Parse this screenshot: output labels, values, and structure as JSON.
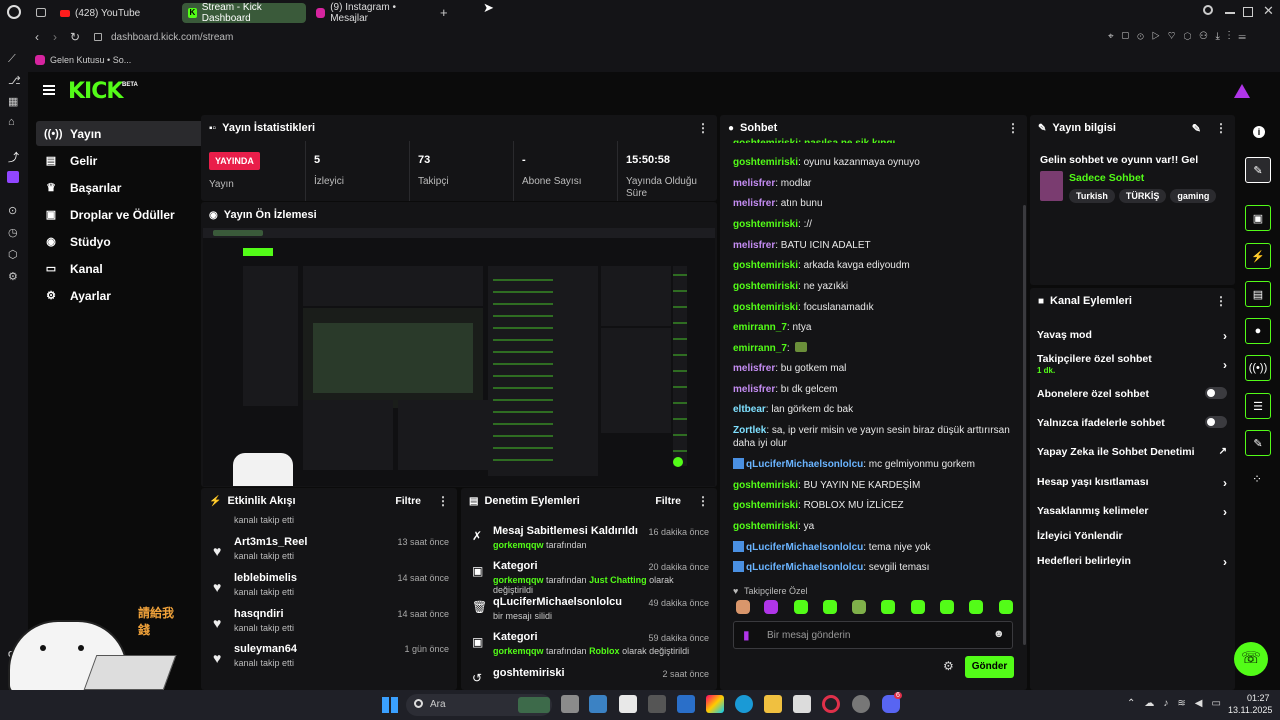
{
  "browser": {
    "tabs": [
      "(428) YouTube",
      "Stream - Kick Dashboard",
      "(9) Instagram • Mesajlar"
    ],
    "url": "dashboard.kick.com/stream",
    "bookmark": "Gelen Kutusu • So...",
    "gx": "GX"
  },
  "kick": {
    "logo": "KICK",
    "beta": "BETA"
  },
  "nav": {
    "items": [
      "Yayın",
      "Gelir",
      "Başarılar",
      "Droplar ve Ödüller",
      "Stüdyo",
      "Kanal",
      "Ayarlar"
    ]
  },
  "stats": {
    "title": "Yayın İstatistikleri",
    "live_badge": "YAYINDA",
    "live_label": "Yayın",
    "viewers": "5",
    "viewers_label": "İzleyici",
    "followers": "73",
    "followers_label": "Takipçi",
    "subs": "-",
    "subs_label": "Abone Sayısı",
    "uptime": "15:50:58",
    "uptime_label1": "Yayında Olduğu",
    "uptime_label2": "Süre"
  },
  "preview": {
    "title": "Yayın Ön İzlemesi",
    "sticker_text": "請給我錢"
  },
  "activity": {
    "title": "Etkinlik Akışı",
    "filter": "Filtre",
    "partial": "kanalı takip etti",
    "rows": [
      {
        "name": "Art3m1s_Reel",
        "sub": "kanalı takip etti",
        "time": "13 saat önce"
      },
      {
        "name": "leblebimelis",
        "sub": "kanalı takip etti",
        "time": "14 saat önce"
      },
      {
        "name": "hasqndiri",
        "sub": "kanalı takip etti",
        "time": "14 saat önce"
      },
      {
        "name": "suleyman64",
        "sub": "kanalı takip etti",
        "time": "1 gün önce"
      }
    ]
  },
  "mod": {
    "title": "Denetim Eylemleri",
    "filter": "Filtre",
    "rows": [
      {
        "title": "Mesaj Sabitlemesi Kaldırıldı",
        "user": "gorkemqqw",
        "s1": " tarafından",
        "s2": "",
        "s3": "",
        "time": "16 dakika önce"
      },
      {
        "title": "Kategori",
        "user": "gorkemqqw",
        "s1": " tarafından ",
        "s2": "Just Chatting",
        "s3": " olarak değiştirildi",
        "time": "20 dakika önce"
      },
      {
        "title": "qLuciferMichaelsonlolcu",
        "user": "",
        "s1": "bir mesajı silidi",
        "s2": "",
        "s3": "",
        "time": "49 dakika önce"
      },
      {
        "title": "Kategori",
        "user": "gorkemqqw",
        "s1": " tarafından ",
        "s2": "Roblox",
        "s3": " olarak değiştirildi",
        "time": "59 dakika önce"
      },
      {
        "title": "goshtemiriski",
        "user": "",
        "s1": "",
        "s2": "",
        "s3": "",
        "time": "2 saat önce"
      }
    ]
  },
  "chat": {
    "title": "Sohbet",
    "partial": "goshtemiriski: nasılsa ne sik kıngı",
    "messages": [
      {
        "user": "goshtemiriski",
        "text": "oyunu kazanmaya oynuyo"
      },
      {
        "user": "melisfrer",
        "text": "modlar"
      },
      {
        "user": "melisfrer",
        "text": "atın bunu"
      },
      {
        "user": "goshtemiriski",
        "text": "://"
      },
      {
        "user": "melisfrer",
        "text": "BATU ICIN ADALET"
      },
      {
        "user": "goshtemiriski",
        "text": "arkada kavga ediyoudm"
      },
      {
        "user": "goshtemiriski",
        "text": "ne yazıkki"
      },
      {
        "user": "goshtemiriski",
        "text": "focuslanamadık"
      },
      {
        "user": "emirrann_7",
        "text": "ntya"
      },
      {
        "user": "emirrann_7",
        "text": ""
      },
      {
        "user": "melisfrer",
        "text": "bu gotkem mal"
      },
      {
        "user": "melisfrer",
        "text": "bı dk gelcem"
      },
      {
        "user": "eltbear",
        "text": "lan görkem dc bak"
      },
      {
        "user": "Zortlek",
        "text": "sa, ip verir misin ve yayın sesin biraz düşük arttırırsan daha iyi olur"
      },
      {
        "user": "qLuciferMichaelsonlolcu",
        "text": "mc gelmiyonmu gorkem"
      },
      {
        "user": "goshtemiriski",
        "text": "BU YAYIN NE KARDEŞİM"
      },
      {
        "user": "goshtemiriski",
        "text": "ROBLOX MU İZLİCEZ"
      },
      {
        "user": "goshtemiriski",
        "text": "ya"
      },
      {
        "user": "qLuciferMichaelsonlolcu",
        "text": "tema niye yok"
      },
      {
        "user": "qLuciferMichaelsonlolcu",
        "text": "sevgili teması"
      }
    ],
    "emote_label": "Takipçilere Özel",
    "placeholder": "Bir mesaj gönderin",
    "send": "Gönder"
  },
  "info": {
    "title": "Yayın bilgisi",
    "stream_title": "Gelin sohbet ve oyunn var!! Gel",
    "category": "Sadece Sohbet",
    "tags": [
      "Turkish",
      "TÜRKİŞ",
      "gaming"
    ]
  },
  "actions": {
    "title": "Kanal Eylemleri",
    "items": [
      "Yavaş mod",
      "Takipçilere özel sohbet",
      "Abonelere özel sohbet",
      "Yalnızca ifadelerle sohbet",
      "Yapay Zeka ile Sohbet Denetimi",
      "Hesap yaşı kısıtlaması",
      "Yasaklanmış kelimeler",
      "İzleyici Yönlendir",
      "Hedefleri belirleyin"
    ],
    "follower_sub": "1 dk."
  },
  "taskbar": {
    "search": "Ara",
    "time": "01:27",
    "date": "13.11.2025",
    "badge": "6"
  },
  "colors": {
    "accent": "#53fc18",
    "live": "#e91e4a",
    "user_green": "#53fc18",
    "user_purple": "#c48cf2",
    "user_blue": "#6ab4ff"
  }
}
